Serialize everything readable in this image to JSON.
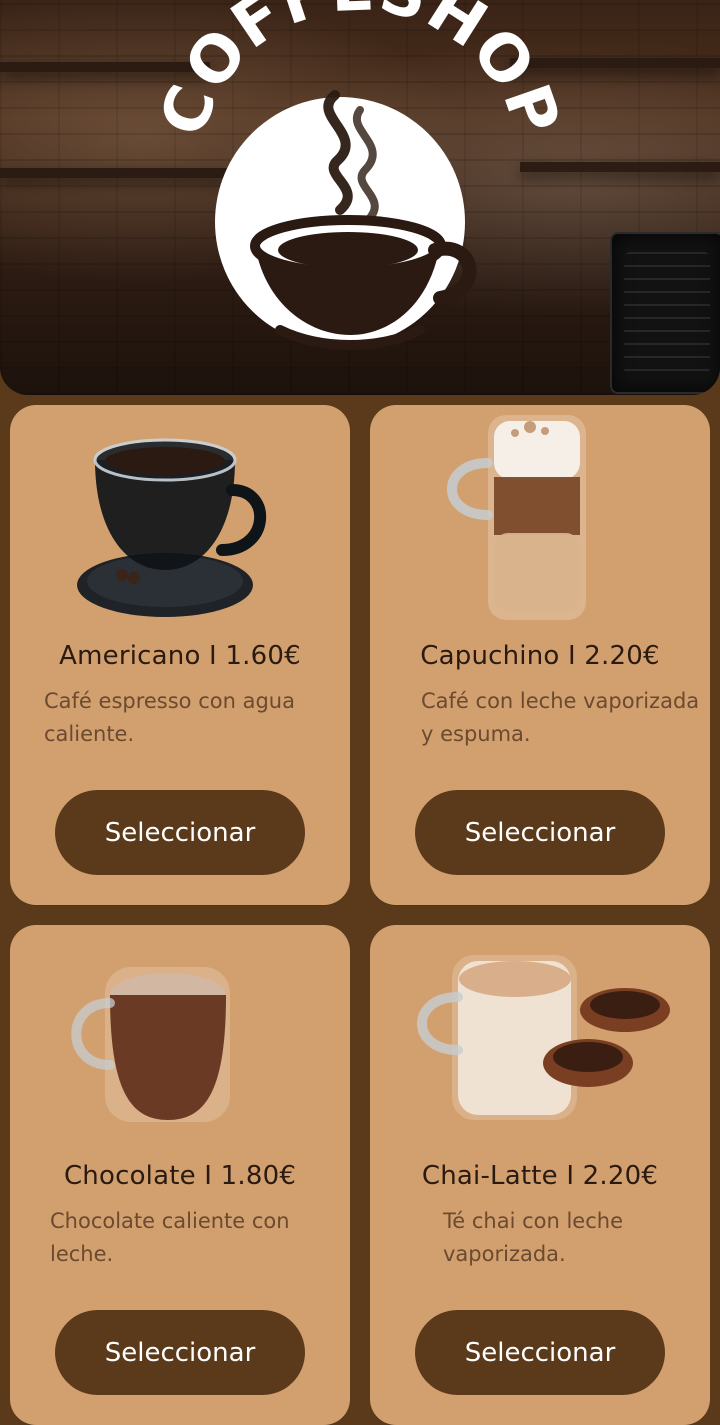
{
  "header": {
    "brand_text": "COFFESHOP",
    "icons": [
      "coffee-cup-icon"
    ]
  },
  "products": [
    {
      "id": "americano",
      "title": "Americano I 1.60€",
      "description": "Café espresso con agua caliente.",
      "button_label": "Seleccionar",
      "image_icon": "espresso-cup-icon"
    },
    {
      "id": "capuchino",
      "title": "Capuchino I 2.20€",
      "description": "Café con leche vaporizada y espuma.",
      "button_label": "Seleccionar",
      "image_icon": "latte-glass-icon"
    },
    {
      "id": "chocolate",
      "title": "Chocolate I 1.80€",
      "description": "Chocolate caliente con leche.",
      "button_label": "Seleccionar",
      "image_icon": "hot-chocolate-mug-icon"
    },
    {
      "id": "chai-latte",
      "title": "Chai-Latte I 2.20€",
      "description": "Té chai con leche vaporizada.",
      "button_label": "Seleccionar",
      "image_icon": "chai-latte-mug-icon"
    }
  ],
  "colors": {
    "page_bg": "#5a3a1b",
    "card_bg": "#d2a06f",
    "button_bg": "#5b3a1b",
    "title_text": "#2b1a10",
    "description_text": "#6b4a2f",
    "logo": "#ffffff"
  }
}
